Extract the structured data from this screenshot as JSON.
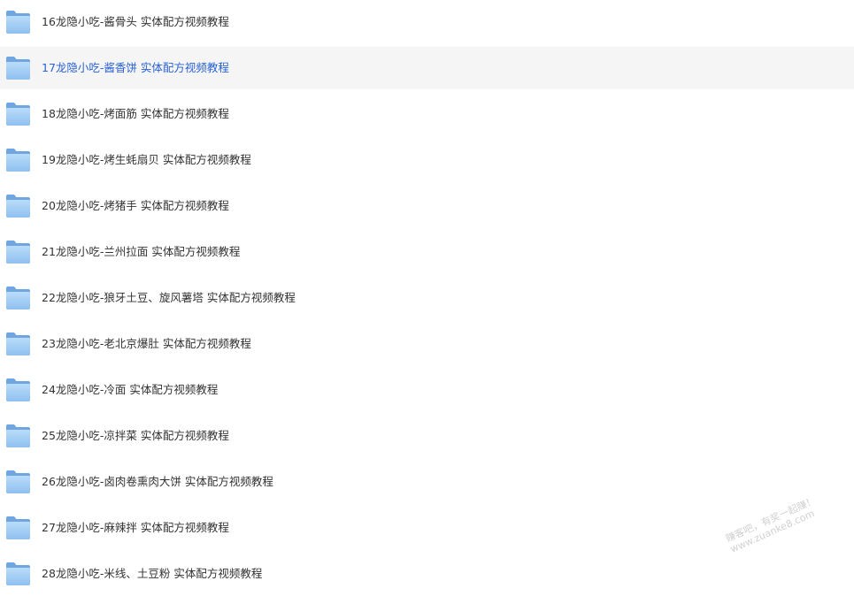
{
  "folders": [
    {
      "name": "16龙隐小吃-酱骨头 实体配方视频教程",
      "selected": false
    },
    {
      "name": "17龙隐小吃-酱香饼 实体配方视频教程",
      "selected": true
    },
    {
      "name": "18龙隐小吃-烤面筋 实体配方视频教程",
      "selected": false
    },
    {
      "name": "19龙隐小吃-烤生蚝扇贝 实体配方视频教程",
      "selected": false
    },
    {
      "name": "20龙隐小吃-烤猪手 实体配方视频教程",
      "selected": false
    },
    {
      "name": "21龙隐小吃-兰州拉面 实体配方视频教程",
      "selected": false
    },
    {
      "name": "22龙隐小吃-狼牙土豆、旋风薯塔 实体配方视频教程",
      "selected": false
    },
    {
      "name": "23龙隐小吃-老北京爆肚 实体配方视频教程",
      "selected": false
    },
    {
      "name": "24龙隐小吃-冷面 实体配方视频教程",
      "selected": false
    },
    {
      "name": "25龙隐小吃-凉拌菜 实体配方视频教程",
      "selected": false
    },
    {
      "name": "26龙隐小吃-卤肉卷熏肉大饼 实体配方视频教程",
      "selected": false
    },
    {
      "name": "27龙隐小吃-麻辣拌 实体配方视频教程",
      "selected": false
    },
    {
      "name": "28龙隐小吃-米线、土豆粉 实体配方视频教程",
      "selected": false
    }
  ],
  "icon": "folder-icon",
  "colors": {
    "folder_back": "#6fa6e0",
    "folder_front": "#a9d1f7",
    "selected_bg": "#f5f5f6",
    "selected_text": "#2a62d4",
    "text": "#333333"
  },
  "watermark": {
    "line1": "赚客吧，有奖一起赚！",
    "line2": "www.zuanke8.com"
  }
}
